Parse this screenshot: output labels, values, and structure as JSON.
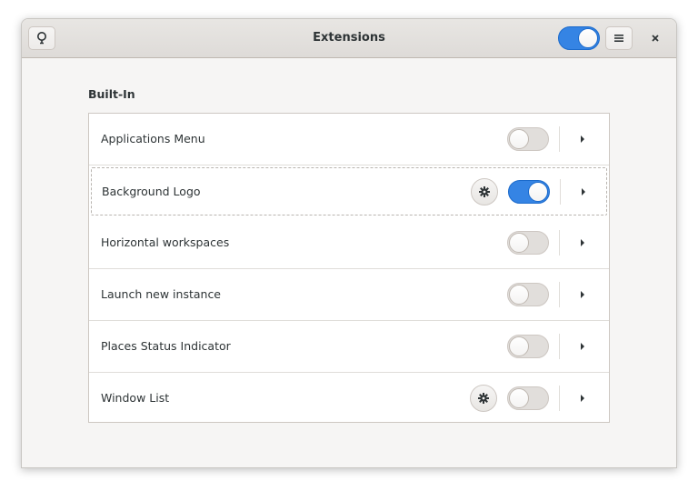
{
  "window": {
    "title": "Extensions",
    "extensions_enabled": true,
    "accent_color": "#3584e4"
  },
  "header": {
    "left_icon": "lightbulb-icon",
    "menu_icon": "hamburger-menu-icon",
    "close_icon": "close-icon"
  },
  "section": {
    "title": "Built-In"
  },
  "extensions": [
    {
      "label": "Applications Menu",
      "enabled": false,
      "has_settings": false
    },
    {
      "label": "Background Logo",
      "enabled": true,
      "has_settings": true,
      "focused": true
    },
    {
      "label": "Horizontal workspaces",
      "enabled": false,
      "has_settings": false
    },
    {
      "label": "Launch new instance",
      "enabled": false,
      "has_settings": false
    },
    {
      "label": "Places Status Indicator",
      "enabled": false,
      "has_settings": false
    },
    {
      "label": "Window List",
      "enabled": false,
      "has_settings": true
    }
  ]
}
